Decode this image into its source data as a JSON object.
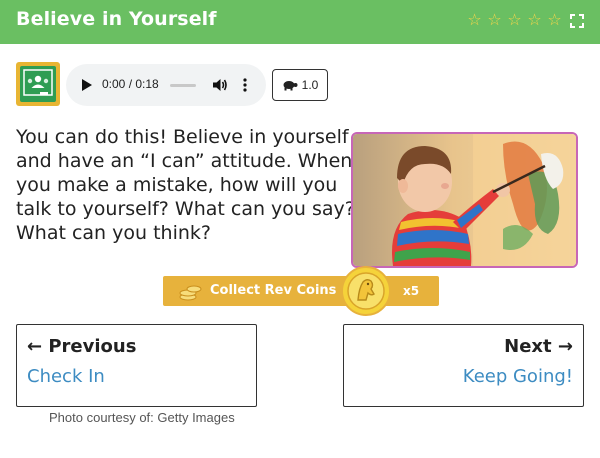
{
  "header": {
    "title": "Believe in Yourself",
    "rating": {
      "max": 5,
      "filled": 0,
      "color": "#f5d54a"
    },
    "accent": "#6abf62"
  },
  "audio": {
    "time": "0:00 / 0:18",
    "progress": 0,
    "speed": "1.0"
  },
  "content": {
    "lines": [
      "You can do this! Believe in yourself",
      "and have an “I can” attitude. When",
      "you make a mistake, how will you",
      "talk to yourself? What can you say?",
      "What can you think?"
    ]
  },
  "coins": {
    "label": "Collect Rev Coins",
    "multiplier": "x5",
    "color": "#e7b23c"
  },
  "nav": {
    "previous": {
      "heading": "← Previous",
      "sub": "Check In"
    },
    "next": {
      "heading": "Next →",
      "sub": "Keep Going!"
    }
  },
  "credit": "Photo courtesy of: Getty Images",
  "icons": [
    "classroom-icon",
    "play-icon",
    "volume-icon",
    "more-icon",
    "turtle-icon",
    "star-icon",
    "fullscreen-icon",
    "coins-stack-icon",
    "coin-medal-icon"
  ]
}
